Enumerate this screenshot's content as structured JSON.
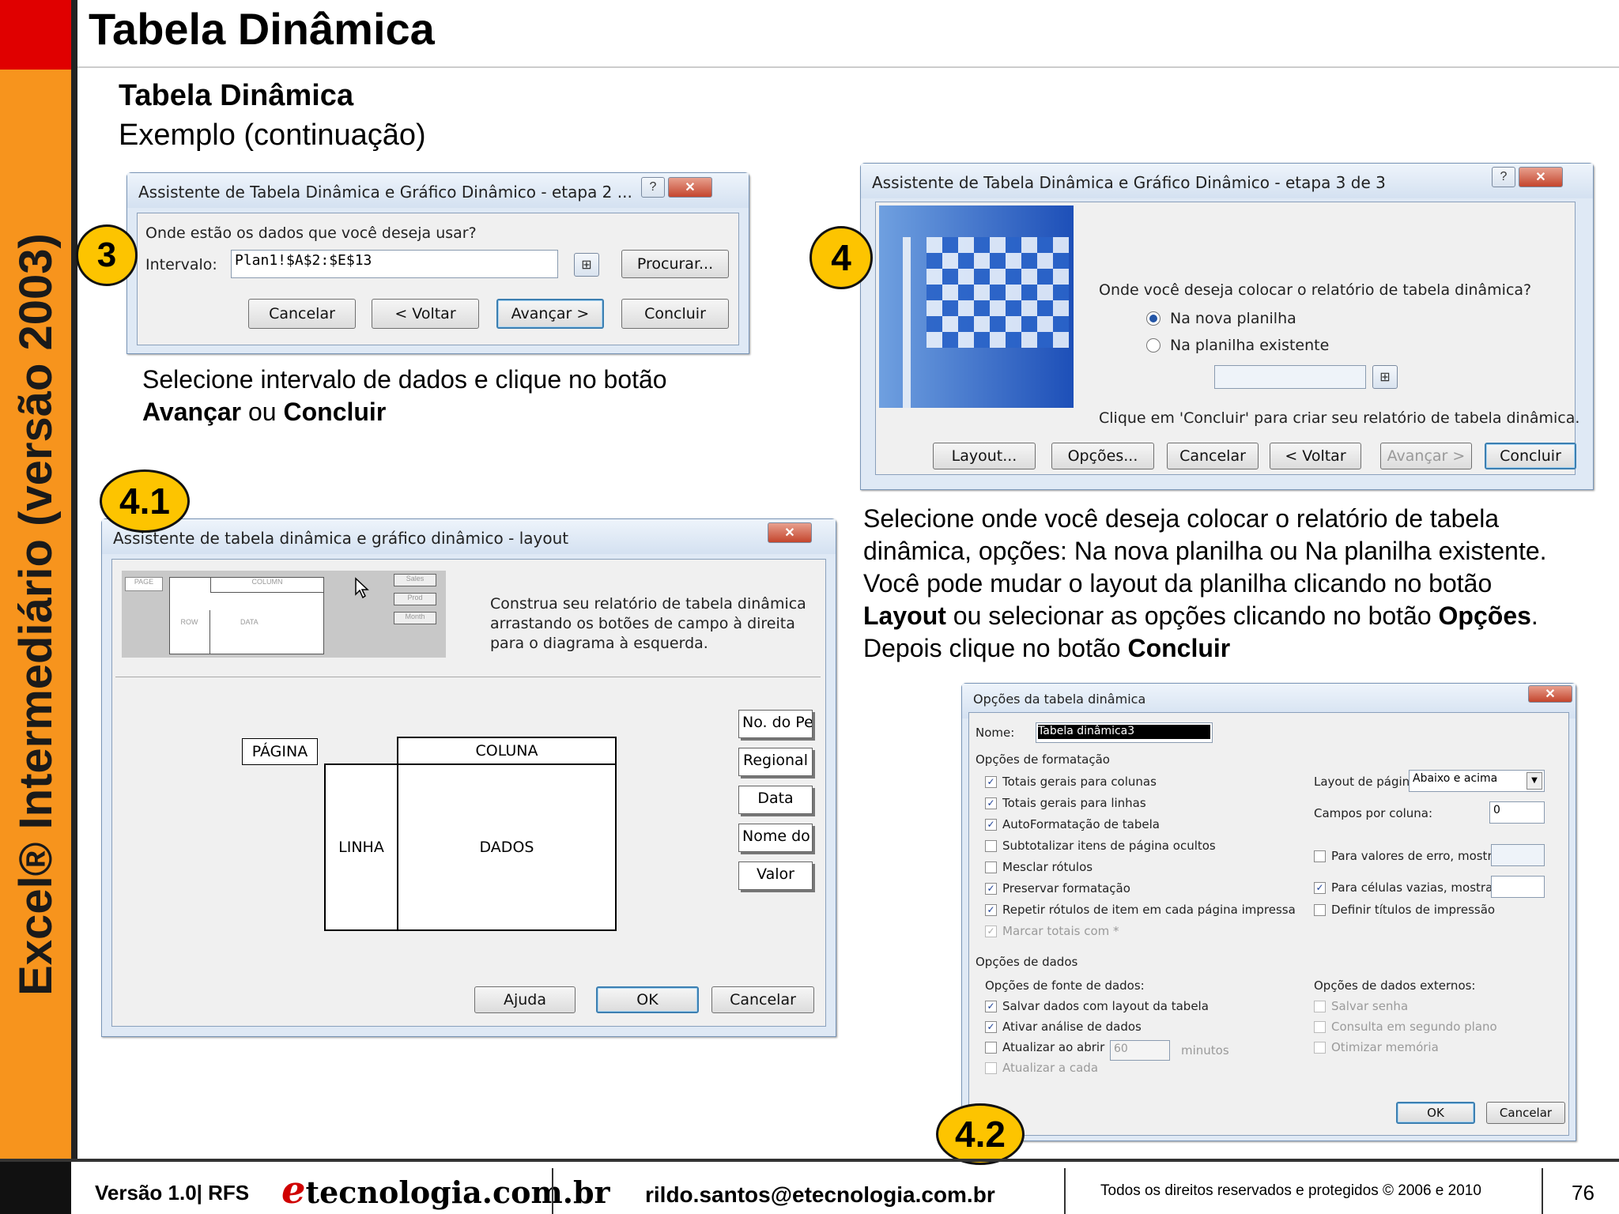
{
  "side_title": "Excel® Intermediário (versão 2003)",
  "page_title": "Tabela Dinâmica",
  "subhead": "Tabela Dinâmica",
  "subhead2": "Exemplo (continuação)",
  "badges": {
    "b3": "3",
    "b4": "4",
    "b41": "4.1",
    "b42": "4.2"
  },
  "dlg3": {
    "title": "Assistente de Tabela Dinâmica e Gráfico Dinâmico - etapa 2 ...",
    "question": "Onde estão os dados que você deseja usar?",
    "range_label": "Intervalo:",
    "range_value": "Plan1!$A$2:$E$13",
    "browse": "Procurar...",
    "cancel": "Cancelar",
    "back": "< Voltar",
    "next": "Avançar >",
    "finish": "Concluir"
  },
  "caption3": {
    "line1": "Selecione intervalo de  dados e clique no botão",
    "b1": "Avançar",
    "mid": " ou ",
    "b2": "Concluir"
  },
  "dlg4": {
    "title": "Assistente de Tabela Dinâmica e Gráfico Dinâmico - etapa 3 de 3",
    "question": "Onde você deseja colocar o relatório de tabela dinâmica?",
    "opt_new": "Na nova planilha",
    "opt_existing": "Na planilha existente",
    "hint": "Clique em 'Concluir' para criar seu relatório de tabela dinâmica.",
    "layout": "Layout...",
    "options": "Opções...",
    "cancel": "Cancelar",
    "back": "< Voltar",
    "next": "Avançar >",
    "finish": "Concluir"
  },
  "caption4": {
    "l1": "Selecione onde você deseja colocar o relatório de tabela",
    "l2": "dinâmica, opções: Na nova planilha ou Na planilha existente.",
    "l3": "Você pode mudar o layout da planilha clicando no botão",
    "b1": "Layout",
    "l4": " ou selecionar as opções clicando no botão ",
    "b2": "Opções",
    "l4end": ".",
    "l5": "Depois clique no botão ",
    "b3": "Concluir"
  },
  "dlg41": {
    "title": "Assistente de tabela dinâmica e gráfico dinâmico - layout",
    "instructions": "Construa seu relatório de tabela dinâmica arrastando os botões de campo à direita para o diagrama à esquerda.",
    "mini": {
      "page": "PAGE",
      "column": "COLUMN",
      "row": "ROW",
      "data": "DATA",
      "f1": "Sales",
      "f2": "Prod",
      "f3": "Month"
    },
    "page": "PÁGINA",
    "column": "COLUNA",
    "row": "LINHA",
    "data": "DADOS",
    "fields": [
      "No. do Pe",
      "Regional",
      "Data",
      "Nome do",
      "Valor"
    ],
    "help": "Ajuda",
    "ok": "OK",
    "cancel": "Cancelar"
  },
  "dlg42": {
    "title": "Opções da tabela dinâmica",
    "name_label": "Nome:",
    "name_value": "Tabela dinâmica3",
    "format_group": "Opções de formatação",
    "format_opts": [
      {
        "label": "Totais gerais para colunas",
        "checked": true
      },
      {
        "label": "Totais gerais para linhas",
        "checked": true
      },
      {
        "label": "AutoFormatação de tabela",
        "checked": true
      },
      {
        "label": "Subtotalizar itens de página ocultos",
        "checked": false
      },
      {
        "label": "Mesclar rótulos",
        "checked": false
      },
      {
        "label": "Preservar formatação",
        "checked": true
      },
      {
        "label": "Repetir rótulos de item em cada página impressa",
        "checked": true
      },
      {
        "label": "Marcar totais com *",
        "checked": true
      }
    ],
    "page_layout_label": "Layout de página:",
    "page_layout_value": "Abaixo e acima",
    "fields_per_col_label": "Campos por coluna:",
    "fields_per_col_value": "0",
    "error_label": "Para valores de erro, mostrar:",
    "empty_label": "Para células vazias, mostrar:",
    "print_titles": "Definir títulos de impressão",
    "data_group": "Opções de dados",
    "source_label": "Opções de fonte de dados:",
    "source_opts": [
      {
        "label": "Salvar dados com layout da tabela",
        "checked": true
      },
      {
        "label": "Ativar análise de dados",
        "checked": true
      },
      {
        "label": "Atualizar ao abrir",
        "checked": false
      },
      {
        "label": "Atualizar a cada",
        "checked": false
      }
    ],
    "refresh_value": "60",
    "minutes": "minutos",
    "external_label": "Opções de dados externos:",
    "external_opts": [
      "Salvar senha",
      "Consulta em segundo plano",
      "Otimizar memória"
    ],
    "ok": "OK",
    "cancel": "Cancelar"
  },
  "footer": {
    "version": "Versão 1.0| RFS",
    "logo_e": "e",
    "logo_rest": "tecnologia.com.br",
    "email": "rildo.santos@etecnologia.com.br",
    "rights": "Todos os direitos reservados e protegidos © 2006 e 2010",
    "page": "76"
  },
  "colors": {
    "accent": "#f7941d",
    "red": "#e00000",
    "badge": "#fdc400"
  }
}
